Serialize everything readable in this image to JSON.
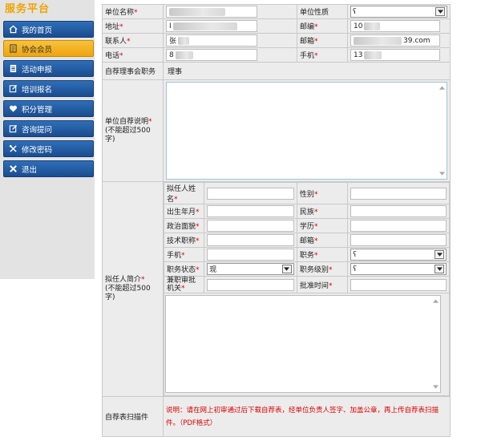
{
  "sidebar": {
    "brand": "服务平台",
    "items": [
      {
        "label": "我的首页",
        "icon": "home-icon"
      },
      {
        "label": "协会会员",
        "icon": "member-card-icon"
      },
      {
        "label": "活动申报",
        "icon": "document-icon"
      },
      {
        "label": "培训报名",
        "icon": "edit-icon"
      },
      {
        "label": "积分管理",
        "icon": "heart-icon"
      },
      {
        "label": "咨询提问",
        "icon": "edit-icon"
      },
      {
        "label": "修改密码",
        "icon": "tools-icon"
      },
      {
        "label": "退出",
        "icon": "close-icon"
      }
    ],
    "active_index": 1
  },
  "form": {
    "unit_name": {
      "label": "单位名称",
      "value": ""
    },
    "unit_type": {
      "label": "单位性质",
      "value": "ʕ"
    },
    "address": {
      "label": "地址",
      "value": "I"
    },
    "postcode": {
      "label": "邮编",
      "value": "10"
    },
    "contact": {
      "label": "联系人",
      "value": "张"
    },
    "email": {
      "label": "邮箱",
      "value_prefix": "",
      "value_suffix": "39.com"
    },
    "phone": {
      "label": "电话",
      "value": "8"
    },
    "mobile": {
      "label": "手机",
      "value": "13"
    },
    "council_position": {
      "label": "自荐理事会职务",
      "value": "理事"
    },
    "self_intro": {
      "label": "单位自荐说明",
      "hint": "(不能超过500字)"
    },
    "nominee": {
      "label": "拟任人简介",
      "hint": "(不能超过500字)",
      "name": "拟任人姓名",
      "gender": "性别",
      "birth": "出生年月",
      "ethnicity": "民族",
      "politics": "政治面貌",
      "education": "学历",
      "title": "技术职称",
      "email": "邮箱",
      "mobile": "手机",
      "position": "职务",
      "position_value": "ʕ",
      "position_status": "职务状态",
      "position_status_value": "现",
      "position_level": "职务级别",
      "position_level_value": "ʕ",
      "approval_org": "兼职审批机关",
      "approval_time": "批准时间"
    },
    "scan": {
      "label": "自荐表扫描件",
      "note": "说明：请在网上初审通过后下载自荐表，经单位负责人签字、加盖公章，再上传自荐表扫描件。（PDF格式）"
    }
  }
}
